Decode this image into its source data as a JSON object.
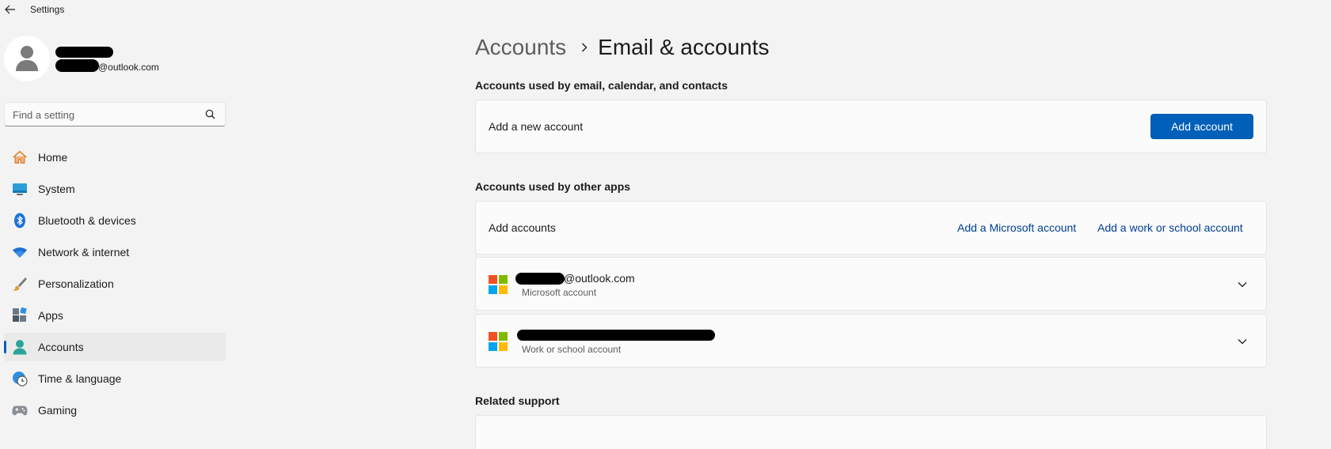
{
  "window": {
    "title": "Settings"
  },
  "profile": {
    "email_suffix": "@outlook.com"
  },
  "search": {
    "placeholder": "Find a setting"
  },
  "nav": [
    {
      "label": "Home",
      "icon": "home-icon",
      "active": false
    },
    {
      "label": "System",
      "icon": "system-icon",
      "active": false
    },
    {
      "label": "Bluetooth & devices",
      "icon": "bluetooth-icon",
      "active": false
    },
    {
      "label": "Network & internet",
      "icon": "wifi-icon",
      "active": false
    },
    {
      "label": "Personalization",
      "icon": "brush-icon",
      "active": false
    },
    {
      "label": "Apps",
      "icon": "apps-icon",
      "active": false
    },
    {
      "label": "Accounts",
      "icon": "accounts-icon",
      "active": true
    },
    {
      "label": "Time & language",
      "icon": "clock-globe-icon",
      "active": false
    },
    {
      "label": "Gaming",
      "icon": "gamepad-icon",
      "active": false
    }
  ],
  "breadcrumb": {
    "parent": "Accounts",
    "current": "Email & accounts"
  },
  "sections": {
    "email_accounts_title": "Accounts used by email, calendar, and contacts",
    "other_apps_title": "Accounts used by other apps",
    "related_support_title": "Related support"
  },
  "add_new_account": {
    "label": "Add a new account",
    "button": "Add account"
  },
  "add_accounts": {
    "label": "Add accounts",
    "microsoft_link": "Add a Microsoft account",
    "work_link": "Add a work or school account"
  },
  "accounts": [
    {
      "name_suffix": "@outlook.com",
      "type": "Microsoft account"
    },
    {
      "name_suffix": "",
      "type": "Work or school account"
    }
  ],
  "colors": {
    "accent": "#005fb8",
    "link": "#003e92",
    "background": "#f3f3f3",
    "card": "#fbfbfb",
    "ms_red": "#f25022",
    "ms_green": "#7fba00",
    "ms_blue": "#00a4ef",
    "ms_yellow": "#ffb900"
  }
}
